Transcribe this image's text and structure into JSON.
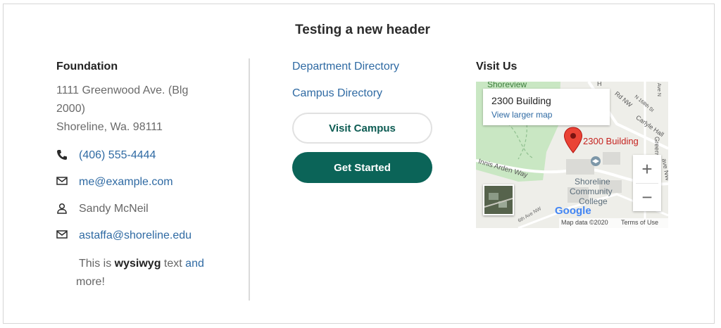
{
  "header": {
    "title": "Testing a new header"
  },
  "foundation": {
    "title": "Foundation",
    "address_line1": "1111 Greenwood Ave. (Blg 2000)",
    "address_line2": "Shoreline, Wa. 98111",
    "phone": "(406) 555-4444",
    "email": "me@example.com",
    "person": "Sandy McNeil",
    "email2": "astaffa@shoreline.edu",
    "wysiwyg_pre": "This is ",
    "wysiwyg_bold": "wysiwyg",
    "wysiwyg_mid": " text ",
    "wysiwyg_link": "and",
    "wysiwyg_post": " more!"
  },
  "links": {
    "department_directory": "Department Directory",
    "campus_directory": "Campus Directory",
    "visit_campus": "Visit Campus",
    "get_started": "Get Started"
  },
  "visit": {
    "title": "Visit Us",
    "map": {
      "card_title": "2300 Building",
      "card_link": "View larger map",
      "pin_label": "2300 Building",
      "place_label_1": "Shoreline",
      "place_label_2": "Community",
      "place_label_3": "College",
      "area_label": "Shoreview",
      "road_1": "Innis Arden Way",
      "road_2": "Carlyle Hall",
      "road_3": "Greenwood Ave",
      "road_4": "N 168th St",
      "road_5": "6th Ave NW",
      "road_6": "Ave N",
      "road_7": "Rd NW",
      "road_8": "H",
      "road_9": "ave NW",
      "brand": "Google",
      "attribution": "Map data ©2020",
      "terms": "Terms of Use",
      "zoom_in": "+",
      "zoom_out": "−"
    }
  }
}
